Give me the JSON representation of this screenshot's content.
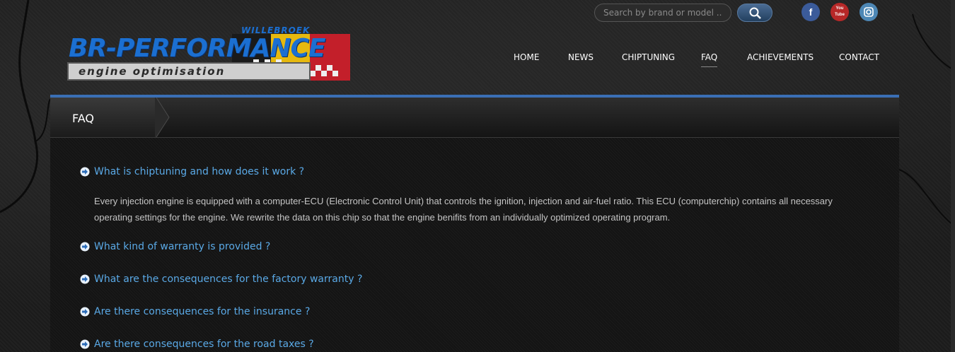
{
  "search": {
    "placeholder": "Search by brand or model ..."
  },
  "social": {
    "facebook": "f",
    "youtube": "You Tube",
    "instagram": "ig"
  },
  "logo": {
    "top_text": "WILLEBROEK",
    "main_text": "BR-PERFORMANCE",
    "sub_text": "engine optimisation"
  },
  "nav": {
    "items": [
      {
        "label": "HOME"
      },
      {
        "label": "NEWS"
      },
      {
        "label": "CHIPTUNING"
      },
      {
        "label": "FAQ"
      },
      {
        "label": "ACHIEVEMENTS"
      },
      {
        "label": "CONTACT"
      }
    ],
    "active": "FAQ"
  },
  "page": {
    "title": "FAQ"
  },
  "faq": {
    "items": [
      {
        "question": "What is chiptuning and how does it work ?",
        "answer": "Every injection engine is equipped with a computer-ECU (Electronic Control Unit) that controls the ignition, injection and air-fuel ratio. This ECU (computerchip) contains all necessary operating settings for the engine. We rewrite the data on this chip so that the engine benifits from an individually optimized operating program."
      },
      {
        "question": "What kind of warranty is provided ?"
      },
      {
        "question": "What are the consequences for the factory warranty ?"
      },
      {
        "question": "Are there consequences for the insurance ?"
      },
      {
        "question": "Are there consequences for the road taxes ?"
      }
    ]
  },
  "colors": {
    "accent": "#3a6fb5",
    "link": "#5aa9e6"
  }
}
